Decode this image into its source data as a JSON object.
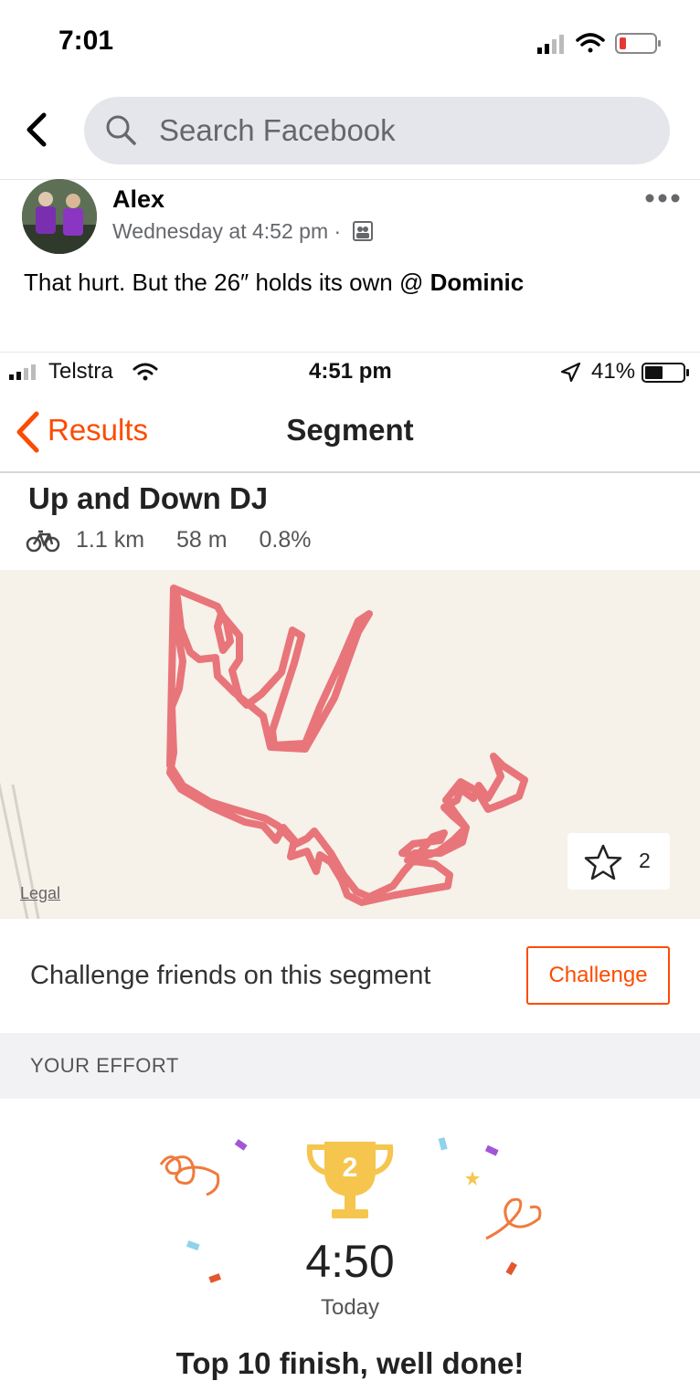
{
  "status_bar": {
    "time": "7:01"
  },
  "header": {
    "search_placeholder": "Search Facebook"
  },
  "post": {
    "author": "Alex",
    "meta": "Wednesday at 4:52 pm ·",
    "text_before": "That hurt. But the 26″ holds its own @ ",
    "mention": "Dominic"
  },
  "screenshot": {
    "status": {
      "carrier": "Telstra",
      "time": "4:51 pm",
      "battery": "41%"
    },
    "nav": {
      "back_label": "Results",
      "title": "Segment"
    },
    "segment": {
      "name": "Up and Down DJ",
      "distance": "1.1 km",
      "elevation": "58 m",
      "grade": "0.8%"
    },
    "map": {
      "legal": "Legal",
      "star_count": "2",
      "route_color": "#e8757a"
    },
    "challenge": {
      "text": "Challenge friends on this segment",
      "button": "Challenge"
    },
    "effort": {
      "section_label": "YOUR EFFORT",
      "rank": "2",
      "time": "4:50",
      "day": "Today",
      "message": "Top 10 finish, well done!"
    }
  },
  "colors": {
    "strava_orange": "#fc4c02",
    "trophy_gold": "#f5c54e"
  }
}
